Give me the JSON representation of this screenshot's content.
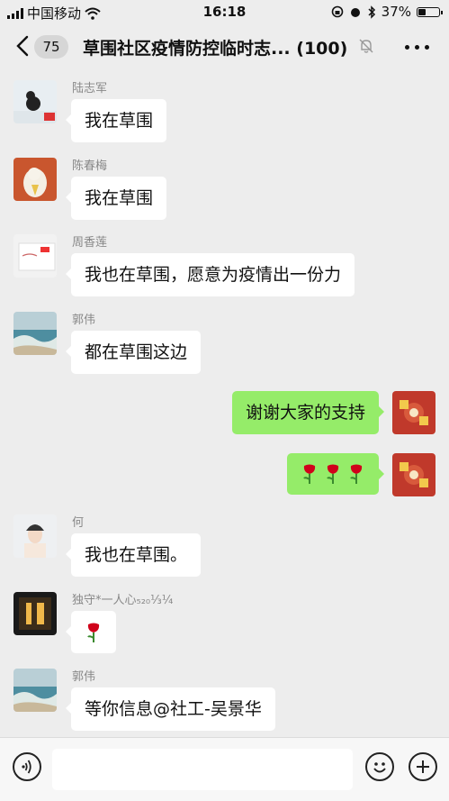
{
  "status": {
    "carrier": "中国移动",
    "time": "16:18",
    "battery": "37%",
    "battery_level": 0.37
  },
  "nav": {
    "unread_count": "75",
    "title": "草围社区疫情防控临时志... (100)"
  },
  "messages": [
    {
      "sender": "陆志军",
      "text": "我在草围"
    },
    {
      "sender": "陈春梅",
      "text": "我在草围"
    },
    {
      "sender": "周香莲",
      "text": "我也在草围，愿意为疫情出一份力"
    },
    {
      "sender": "郭伟",
      "text": "都在草围这边"
    },
    {
      "sender": "",
      "text": "谢谢大家的支持"
    },
    {
      "sender": "",
      "text": ""
    },
    {
      "sender": "何",
      "text": "我也在草围。"
    },
    {
      "sender": "独守*一人心₅₂₀⅓¼",
      "text": ""
    },
    {
      "sender": "郭伟",
      "text": "等你信息@社工-吴景华"
    }
  ],
  "icons": {
    "voice": "voice-icon",
    "emoji": "emoji-icon",
    "add": "add-icon"
  }
}
